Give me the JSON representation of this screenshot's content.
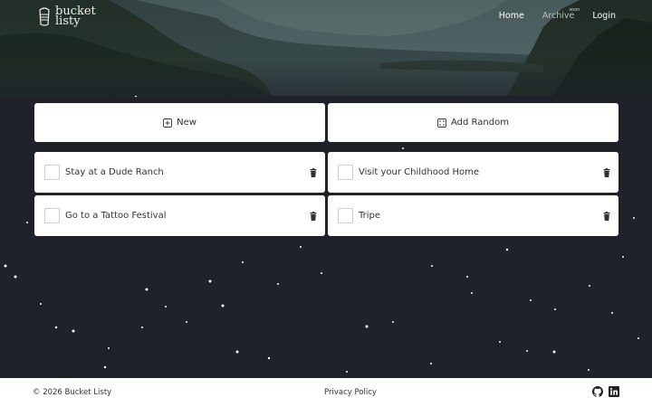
{
  "brand": {
    "name_line1": "bucket",
    "name_line2": "listy"
  },
  "nav": {
    "home": "Home",
    "archive": "Archive",
    "archive_badge": "soon",
    "login": "Login"
  },
  "actions": {
    "new_label": "New",
    "add_random_label": "Add Random"
  },
  "items": [
    {
      "label": "Stay at a Dude Ranch",
      "checked": false
    },
    {
      "label": "Visit your Childhood Home",
      "checked": false
    },
    {
      "label": "Go to a Tattoo Festival",
      "checked": false
    },
    {
      "label": "Tripe",
      "checked": false
    }
  ],
  "footer": {
    "copyright": "© 2026 Bucket Listy",
    "privacy": "Privacy Policy",
    "icons": [
      "github-icon",
      "linkedin-icon"
    ]
  },
  "colors": {
    "background": "#1f2329",
    "card": "#ffffff"
  }
}
